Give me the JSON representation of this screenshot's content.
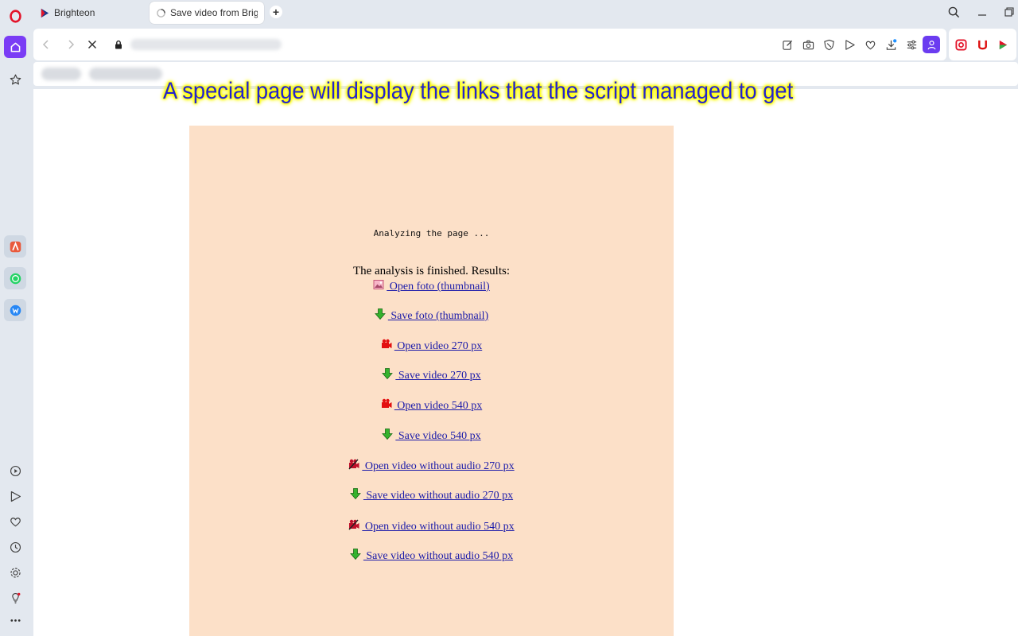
{
  "browser": {
    "tabs": [
      {
        "label": "Brighteon"
      },
      {
        "label": "Save video from Brighteon"
      }
    ],
    "new_tab_label": "+"
  },
  "overlay": {
    "caption": "A special page will display the links that the script managed to get"
  },
  "page": {
    "status": "Analyzing the page ...",
    "results_title": "The analysis is finished. Results:",
    "links": [
      {
        "label": " Open foto (thumbnail)",
        "icon": "image-icon"
      },
      {
        "label": " Save foto (thumbnail)",
        "icon": "download-arrow-icon"
      },
      {
        "label": " Open video 270 px",
        "icon": "video-camera-icon"
      },
      {
        "label": " Save video 270 px",
        "icon": "download-arrow-icon"
      },
      {
        "label": " Open video 540 px",
        "icon": "video-camera-icon"
      },
      {
        "label": " Save video 540 px",
        "icon": "download-arrow-icon"
      },
      {
        "label": " Open video without audio 270 px",
        "icon": "video-camera-muted-icon"
      },
      {
        "label": " Save video without audio 270 px",
        "icon": "download-arrow-icon"
      },
      {
        "label": " Open video without audio 540 px",
        "icon": "video-camera-muted-icon"
      },
      {
        "label": " Save video without audio 540 px",
        "icon": "download-arrow-icon"
      }
    ]
  },
  "colors": {
    "panel_background": "#fce0c8",
    "link": "#1a1aaa",
    "caption_text": "#2323d0",
    "caption_glow": "#ffff00",
    "opera_accent": "#7a3cf5"
  }
}
